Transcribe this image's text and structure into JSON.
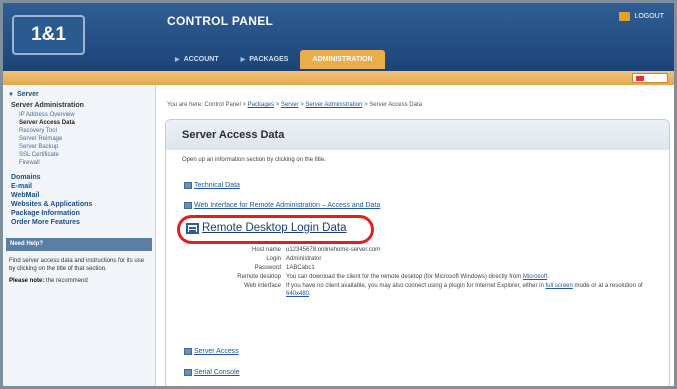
{
  "header": {
    "logo": "1&1",
    "title": "CONTROL PANEL",
    "logout_label": "LOGOUT",
    "tabs": [
      {
        "label": "ACCOUNT"
      },
      {
        "label": "PACKAGES"
      },
      {
        "label": "ADMINISTRATION"
      }
    ]
  },
  "sidebar": {
    "section_title": "Server",
    "subsection": "Server Administration",
    "links": [
      "IP Address Overview",
      "Server Access Data",
      "Recovery Tool",
      "Server Reimage",
      "Server Backup",
      "SSL Certificate",
      "Firewall"
    ],
    "main_items": [
      "Domains",
      "E-mail",
      "WebMail",
      "Websites & Applications",
      "Package Information",
      "Order More Features"
    ],
    "help": {
      "title": "Need Help?",
      "text": "Find server access data and instructions for its use by clicking on the title of that section.",
      "note_bold": "Please note:",
      "note": "the recommend"
    }
  },
  "breadcrumb": {
    "prefix": "You are here: Control Panel >",
    "items": [
      "Packages",
      "Server",
      "Server Administration"
    ],
    "current": "Server Access Data"
  },
  "panel": {
    "title": "Server Access Data",
    "description": "Open up an information section by clicking on the title.",
    "sections": {
      "technical": "Technical Data",
      "web_interface": "Web Interface for Remote Administration – Access and Data",
      "remote_desktop": "Remote Desktop Login Data",
      "server_access": "Server Access",
      "serial_console": "Serial Console"
    },
    "details": {
      "host_label": "Host name",
      "host_value": "u12345678.onlinehome-server.com",
      "login_label": "Login",
      "login_value": "Administrator",
      "password_label": "Password",
      "password_value": "1ABCabc1",
      "rdp_label": "Remote desktop",
      "rdp_value": "You can download the client for the remote desktop (for Microsoft Windows) directly from",
      "rdp_link": "Microsoft",
      "web_label": "Web interface",
      "web_value": "If you have no client available, you may also connect using a plugin for Internet Explorer, either in",
      "web_link1": "full screen",
      "web_mid": "mode or at a resolution of",
      "web_link2": "640x480"
    }
  }
}
